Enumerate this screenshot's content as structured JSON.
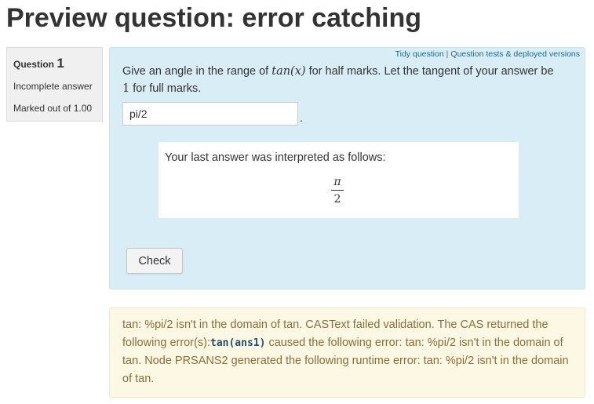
{
  "page": {
    "title": "Preview question: error catching"
  },
  "info": {
    "question_label": "Question",
    "question_number": "1",
    "state": "Incomplete answer",
    "grade": "Marked out of 1.00"
  },
  "links": {
    "tidy": "Tidy question",
    "separator": "|",
    "tests": "Question tests & deployed versions"
  },
  "question": {
    "text_part1": "Give an angle in the range of ",
    "math_tan": "tan(x)",
    "text_part2": " for half marks. Let the tangent of your answer be ",
    "math_one": "1",
    "text_part3": " for full marks."
  },
  "answer": {
    "value": "pi/2",
    "trailing": "."
  },
  "validation": {
    "message": "Your last answer was interpreted as follows:",
    "numerator": "π",
    "denominator": "2"
  },
  "buttons": {
    "check": "Check"
  },
  "outcome": {
    "part1": "tan: %pi/2 isn't in the domain of tan. CASText failed validation. The CAS returned the following error(s):",
    "code": "tan(ans1)",
    "part2": " caused the following error: tan: %pi/2 isn't in the domain of tan. Node PRSANS2 generated the following runtime error: tan: %pi/2 isn't in the domain of tan."
  },
  "colors": {
    "formulation_bg": "#d9edf7",
    "outcome_bg": "#fcf8e3",
    "outcome_text": "#8a6d3b",
    "link": "#1a6b97"
  }
}
